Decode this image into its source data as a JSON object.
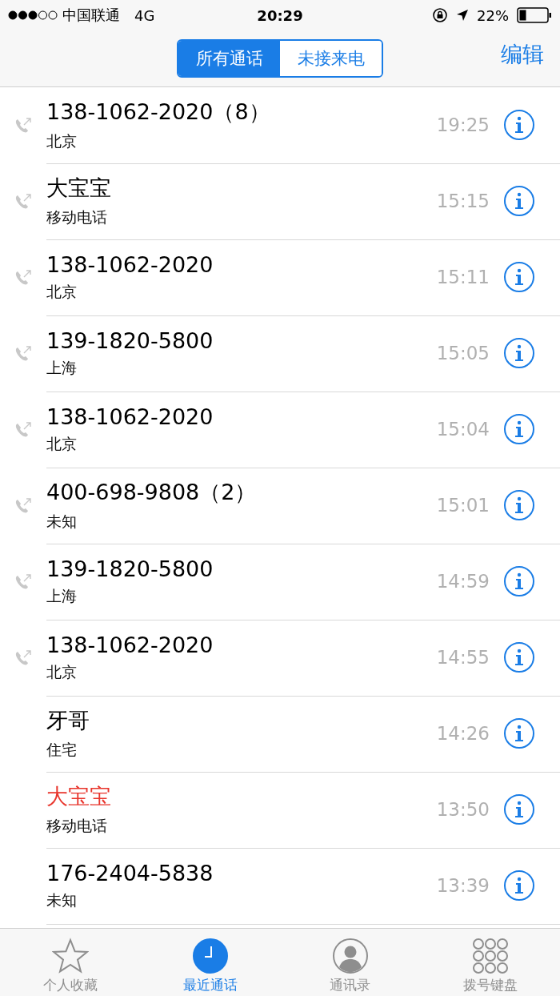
{
  "status_bar": {
    "carrier": "中国联通",
    "network": "4G",
    "time": "20:29",
    "battery": "22%"
  },
  "nav": {
    "segments": [
      {
        "label": "所有通话",
        "selected": true
      },
      {
        "label": "未接来电",
        "selected": false
      }
    ],
    "edit": "编辑"
  },
  "calls": [
    {
      "name": "138-1062-2020（8）",
      "subtitle": "北京",
      "time": "19:25",
      "outgoing": true,
      "missed": false
    },
    {
      "name": "大宝宝",
      "subtitle": "移动电话",
      "time": "15:15",
      "outgoing": true,
      "missed": false
    },
    {
      "name": "138-1062-2020",
      "subtitle": "北京",
      "time": "15:11",
      "outgoing": true,
      "missed": false
    },
    {
      "name": "139-1820-5800",
      "subtitle": "上海",
      "time": "15:05",
      "outgoing": true,
      "missed": false
    },
    {
      "name": "138-1062-2020",
      "subtitle": "北京",
      "time": "15:04",
      "outgoing": true,
      "missed": false
    },
    {
      "name": "400-698-9808（2）",
      "subtitle": "未知",
      "time": "15:01",
      "outgoing": true,
      "missed": false
    },
    {
      "name": "139-1820-5800",
      "subtitle": "上海",
      "time": "14:59",
      "outgoing": true,
      "missed": false
    },
    {
      "name": "138-1062-2020",
      "subtitle": "北京",
      "time": "14:55",
      "outgoing": true,
      "missed": false
    },
    {
      "name": "牙哥",
      "subtitle": "住宅",
      "time": "14:26",
      "outgoing": false,
      "missed": false
    },
    {
      "name": "大宝宝",
      "subtitle": "移动电话",
      "time": "13:50",
      "outgoing": false,
      "missed": true
    },
    {
      "name": "176-2404-5838",
      "subtitle": "未知",
      "time": "13:39",
      "outgoing": false,
      "missed": false
    }
  ],
  "tab_bar": [
    {
      "kind": "favorites",
      "label": "个人收藏",
      "selected": false
    },
    {
      "kind": "recents",
      "label": "最近通话",
      "selected": true
    },
    {
      "kind": "contacts",
      "label": "通讯录",
      "selected": false
    },
    {
      "kind": "keypad",
      "label": "拨号键盘",
      "selected": false
    }
  ]
}
